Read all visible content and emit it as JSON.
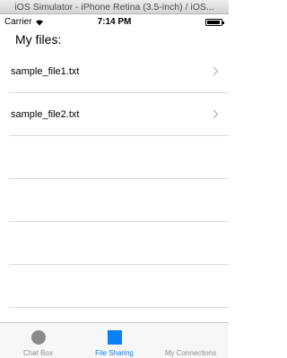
{
  "simulator": {
    "title": "iOS Simulator - iPhone Retina (3.5-inch) / iOS..."
  },
  "status_bar": {
    "carrier": "Carrier",
    "time": "7:14 PM"
  },
  "page": {
    "title": "My files:"
  },
  "files": [
    {
      "name": "sample_file1.txt"
    },
    {
      "name": "sample_file2.txt"
    }
  ],
  "tabs": [
    {
      "label": "Chat Box",
      "icon": "circle-icon"
    },
    {
      "label": "File Sharing",
      "icon": "square-icon",
      "active": true
    },
    {
      "label": "My Connections",
      "icon": "none"
    }
  ],
  "colors": {
    "accent": "#0a7ff5",
    "inactive": "#8e8e8e",
    "separator": "#dcdcdc"
  }
}
